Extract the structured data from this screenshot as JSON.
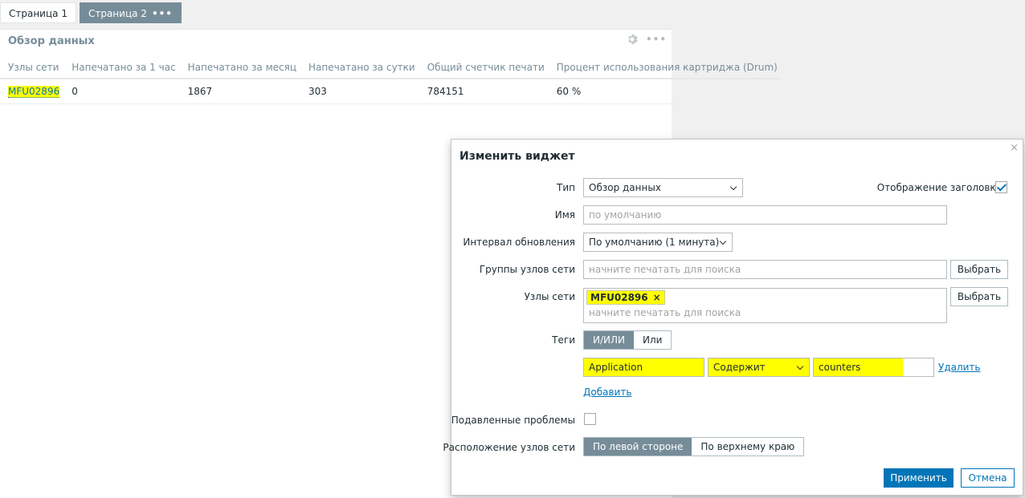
{
  "tabs": [
    {
      "label": "Страница 1",
      "active": false
    },
    {
      "label": "Страница 2",
      "active": true,
      "menu_icon": "more-icon"
    }
  ],
  "widget": {
    "title": "Обзор данных",
    "icons": [
      "gear-icon",
      "more-icon"
    ],
    "columns": [
      "Узлы сети",
      "Напечатано за 1 час",
      "Напечатано за месяц",
      "Напечатано за сутки",
      "Общий счетчик печати",
      "Процент использования картриджа (Drum)"
    ],
    "rows": [
      [
        "MFU02896",
        "0",
        "1867",
        "303",
        "784151",
        "60 %"
      ]
    ]
  },
  "dialog": {
    "title": "Изменить виджет",
    "close": "×",
    "type_label": "Тип",
    "type_value": "Обзор данных",
    "show_header_label": "Отображение заголовка",
    "show_header_checked": true,
    "name_label": "Имя",
    "name_placeholder": "по умолчанию",
    "refresh_label": "Интервал обновления",
    "refresh_value": "По умолчанию (1 минута)",
    "host_groups_label": "Группы узлов сети",
    "host_groups_placeholder": "начните печатать для поиска",
    "select_label": "Выбрать",
    "hosts_label": "Узлы сети",
    "hosts_selected": "MFU02896",
    "hosts_remove": "×",
    "hosts_placeholder": "начните печатать для поиска",
    "tags_label": "Теги",
    "tags_mode": [
      "И/ИЛИ",
      "Или"
    ],
    "tag_name": "Application",
    "tag_operator": "Содержит",
    "tag_value": "counters",
    "remove_label": "Удалить",
    "add_label": "Добавить",
    "suppressed_label": "Подавленные проблемы",
    "suppressed_checked": false,
    "host_location_label": "Расположение узлов сети",
    "host_location_options": [
      "По левой стороне",
      "По верхнему краю"
    ],
    "apply_label": "Применить",
    "cancel_label": "Отмена"
  },
  "colors": {
    "accent": "#0275b8",
    "highlight": "#ffff00",
    "tab_active": "#768d99"
  }
}
